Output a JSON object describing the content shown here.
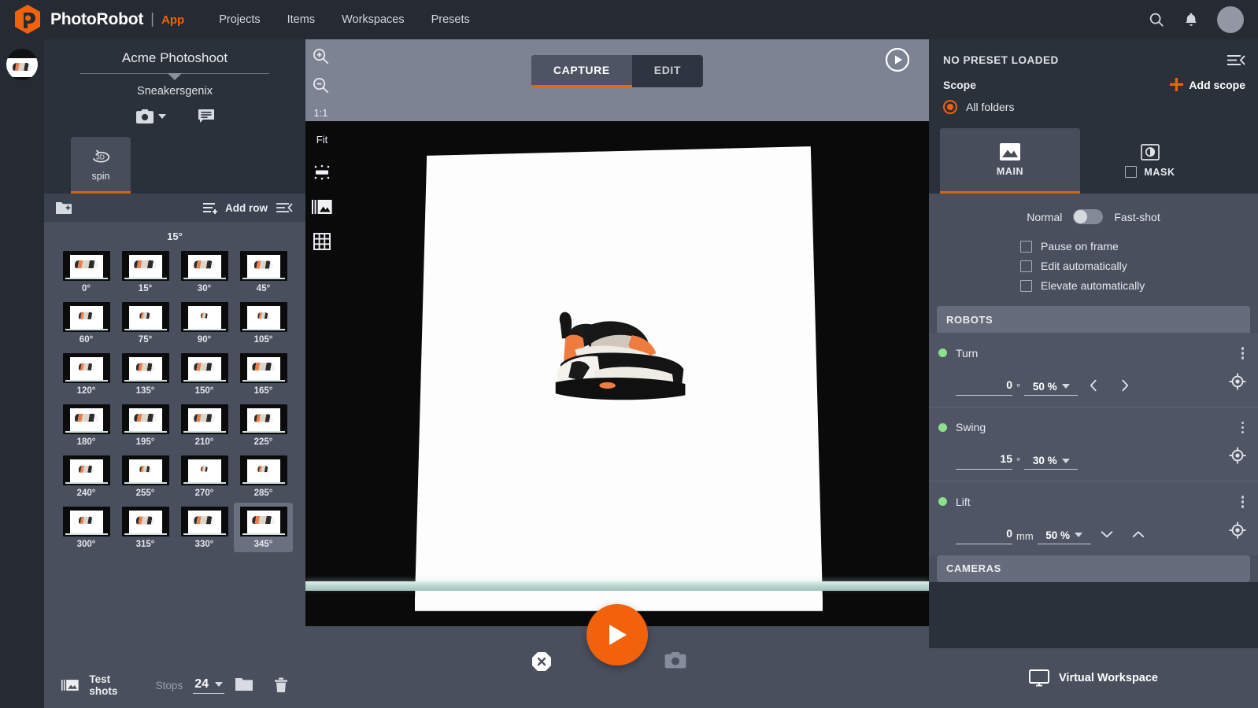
{
  "header": {
    "brand": "PhotoRobot",
    "separator": "|",
    "app_label": "App",
    "nav": [
      {
        "label": "Projects"
      },
      {
        "label": "Items"
      },
      {
        "label": "Workspaces"
      },
      {
        "label": "Presets"
      }
    ],
    "icons": [
      "search-icon",
      "bell-icon",
      "avatar"
    ]
  },
  "left_panel": {
    "shoot_title": "Acme Photoshoot",
    "shoot_subtitle": "Sneakersgenix",
    "tab_3d": {
      "icon": "3d-spin-icon",
      "label": "spin"
    },
    "toolbar": {
      "add_folder_icon": "folder-plus-icon",
      "add_row_label": "Add row",
      "collapse_icon": "collapse-panel-icon"
    },
    "row_label": "15°",
    "thumbnails": [
      {
        "label": "0°",
        "selected": false
      },
      {
        "label": "15°",
        "selected": false
      },
      {
        "label": "30°",
        "selected": false
      },
      {
        "label": "45°",
        "selected": false
      },
      {
        "label": "60°",
        "selected": false
      },
      {
        "label": "75°",
        "selected": false
      },
      {
        "label": "90°",
        "selected": false
      },
      {
        "label": "105°",
        "selected": false
      },
      {
        "label": "120°",
        "selected": false
      },
      {
        "label": "135°",
        "selected": false
      },
      {
        "label": "150°",
        "selected": false
      },
      {
        "label": "165°",
        "selected": false
      },
      {
        "label": "180°",
        "selected": false
      },
      {
        "label": "195°",
        "selected": false
      },
      {
        "label": "210°",
        "selected": false
      },
      {
        "label": "225°",
        "selected": false
      },
      {
        "label": "240°",
        "selected": false
      },
      {
        "label": "255°",
        "selected": false
      },
      {
        "label": "270°",
        "selected": false
      },
      {
        "label": "285°",
        "selected": false
      },
      {
        "label": "300°",
        "selected": false
      },
      {
        "label": "315°",
        "selected": false
      },
      {
        "label": "330°",
        "selected": false
      },
      {
        "label": "345°",
        "selected": true
      }
    ],
    "footer": {
      "test_shots_label": "Test shots",
      "stops_label": "Stops",
      "stops_value": "24",
      "folder_icon": "folder-icon",
      "trash_icon": "trash-icon"
    }
  },
  "center": {
    "zoom_in_icon": "zoom-in-icon",
    "zoom_out_icon": "zoom-out-icon",
    "ratio_label": "1:1",
    "tabs": [
      {
        "label": "CAPTURE",
        "active": true
      },
      {
        "label": "EDIT",
        "active": false
      }
    ],
    "play_preview_icon": "play-circle-icon",
    "stage_tools": {
      "fit_label": "Fit",
      "exposure_icon": "exposure-icon",
      "compare_icon": "compare-images-icon",
      "grid_icon": "grid-icon"
    },
    "bottom": {
      "cancel_icon": "cancel-octagon-icon",
      "shoot_icon": "play-icon",
      "camera_icon": "camera-icon"
    }
  },
  "right_panel": {
    "preset_title": "NO PRESET LOADED",
    "collapse_icon": "collapse-panel-icon",
    "scope_label": "Scope",
    "add_scope_label": "Add scope",
    "all_folders_label": "All folders",
    "tabs": [
      {
        "label": "MAIN",
        "icon": "image-icon",
        "active": true
      },
      {
        "label": "MASK",
        "icon": "mask-icon",
        "active": false
      }
    ],
    "mode_left": "Normal",
    "mode_right": "Fast-shot",
    "checkboxes": [
      {
        "label": "Pause on frame",
        "checked": false
      },
      {
        "label": "Edit automatically",
        "checked": false
      },
      {
        "label": "Elevate automatically",
        "checked": false
      }
    ],
    "robots_header": "ROBOTS",
    "robots": [
      {
        "name": "Turn",
        "status_color": "#8ce08c",
        "value": "0",
        "unit": "°",
        "speed": "50 %",
        "prev_icon": "chevron-left-icon",
        "next_icon": "chevron-right-icon",
        "target_icon": "target-icon"
      },
      {
        "name": "Swing",
        "status_color": "#8ce08c",
        "value": "15",
        "unit": "°",
        "speed": "30 %",
        "prev_icon": "",
        "next_icon": "",
        "target_icon": "target-icon"
      },
      {
        "name": "Lift",
        "status_color": "#8ce08c",
        "value": "0",
        "unit": "mm",
        "speed": "50 %",
        "prev_icon": "chevron-down-icon",
        "next_icon": "chevron-up-icon",
        "target_icon": "target-icon"
      }
    ],
    "cameras_header": "CAMERAS",
    "virtual_workspace_label": "Virtual Workspace"
  },
  "colors": {
    "accent": "#f2610c",
    "accent_underline": "#d4650f",
    "topnav_bg": "#262b33",
    "panel_bg": "#2a313a",
    "panel_light": "#4a4f5d",
    "section_head": "#666c7c",
    "status_green": "#8ce08c",
    "viewer_bg": "#7e8393"
  }
}
